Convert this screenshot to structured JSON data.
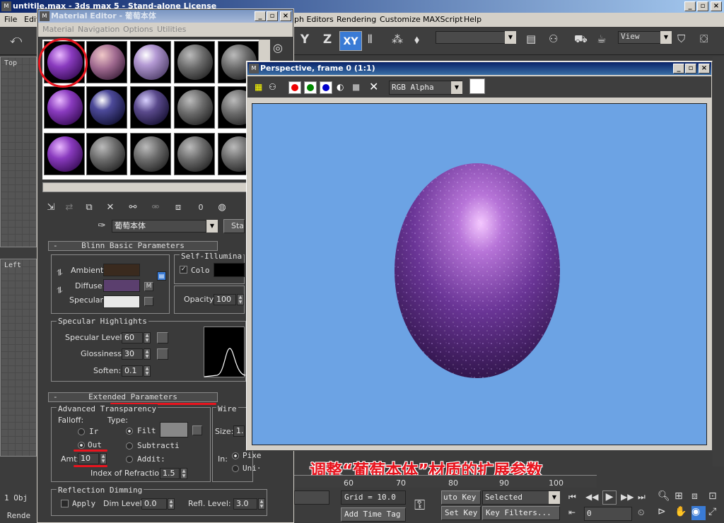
{
  "app": {
    "title": "untitile.max - 3ds max 5 - Stand-alone License",
    "menu_left": [
      "File",
      "Edit"
    ],
    "menu_right": [
      "ph Editors",
      "Rendering",
      "Customize",
      "MAXScript",
      "Help"
    ],
    "axis_labels": [
      "Y",
      "Z",
      "XY"
    ],
    "view_dropdown": "View",
    "viewport_top_label": "Top",
    "viewport_left_label": "Left"
  },
  "material_editor": {
    "title": "Material Editor - 葡萄本体",
    "menu": [
      "Material",
      "Navigation",
      "Options",
      "Utilities"
    ],
    "material_name": "葡萄本体",
    "type_button": "Sta",
    "blinn": {
      "header": "Blinn Basic Parameters",
      "self_illum_label": "Self-Illumina",
      "color_check_label": "Colo",
      "ambient_label": "Ambient:",
      "diffuse_label": "Diffuse:",
      "specular_label": "Specular:",
      "map_letter": "M",
      "opacity_label": "Opacity:",
      "opacity_value": "100",
      "ambient_color": "#3a2a1e",
      "diffuse_color": "#5b3f6e",
      "specular_color": "#e8e8e8"
    },
    "highlights": {
      "header": "Specular Highlights",
      "level_label": "Specular Level:",
      "level_value": "60",
      "gloss_label": "Glossiness:",
      "gloss_value": "30",
      "soften_label": "Soften:",
      "soften_value": "0.1"
    },
    "extended": {
      "header": "Extended Parameters",
      "adv_trans_label": "Advanced Transparency",
      "falloff_label": "Falloff:",
      "type_label": "Type:",
      "falloff_in": "Ir",
      "falloff_out": "Out",
      "type_filter": "Filt",
      "type_subtract": "Subtracti",
      "type_additive": "Addit:",
      "amt_label": "Amt:",
      "amt_value": "10",
      "ior_label": "Index of Refraction:",
      "ior_value": "1.5",
      "wire_label": "Wire",
      "size_label": "Size:",
      "size_value": "1.",
      "in_label": "In:",
      "pixels_label": "Pixe",
      "units_label": "Uni·"
    },
    "reflection": {
      "header": "Reflection Dimming",
      "apply_label": "Apply",
      "dim_label": "Dim Level:",
      "dim_value": "0.0",
      "refl_label": "Refl. Level:",
      "refl_value": "3.0"
    },
    "toolbar_zero": "0"
  },
  "render_window": {
    "title": "Perspective, frame 0 (1:1)",
    "channel_dropdown": "RGB Alpha",
    "background_color": "#6ca3e4"
  },
  "annotation": {
    "caption": "调整“葡萄本体”材质的扩展参数",
    "color": "#e8141e"
  },
  "bottom": {
    "ruler_ticks": [
      "60",
      "70",
      "80",
      "90",
      "100"
    ],
    "grid_label": "Grid = 10.0",
    "add_time_tag": "Add Time Tag",
    "auto_key": "uto Key",
    "set_key": "Set Key",
    "selected_dropdown": "Selected",
    "key_filters": "Key Filters...",
    "frame_field": "0",
    "left_obj": "1 Obj",
    "left_render": "Rende"
  }
}
